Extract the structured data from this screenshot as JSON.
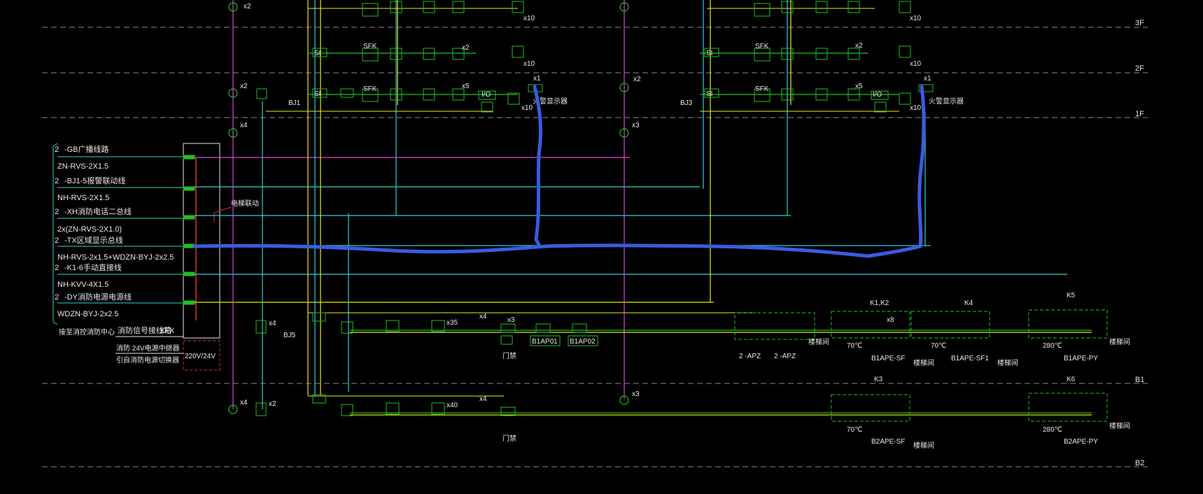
{
  "floors": [
    {
      "key": "3F",
      "label": "3F"
    },
    {
      "key": "2F",
      "label": "2F"
    },
    {
      "key": "1F",
      "label": "1F"
    },
    {
      "key": "B1",
      "label": "B1"
    },
    {
      "key": "B2",
      "label": "B2"
    }
  ],
  "legend": [
    {
      "count": "2",
      "head": "-GB广播线路",
      "spec": "ZN-RVS-2X1.5",
      "line_color": "#e040e0",
      "mark": "BC"
    },
    {
      "count": "2",
      "head": "-BJ1-5报警联动线",
      "spec": "NH-RVS-2X1.5",
      "line_color": "#30d0d0",
      "mark": ""
    },
    {
      "count": "2",
      "head": "-XH消防电话二总线",
      "spec": "2x(ZN-RVS-2X1.0)",
      "line_color": "#30d0d0",
      "mark": "F"
    },
    {
      "count": "2",
      "head": "-TX区域显示总线",
      "spec": "NH-RVS-2x1.5+WDZN-BYJ-2x2.5",
      "line_color": "#30d0d0",
      "mark": "TX"
    },
    {
      "count": "2",
      "head": "-K1-6手动直接线",
      "spec": "NH-KVV-4X1.5",
      "line_color": "#30d0d0",
      "mark": "PC"
    },
    {
      "count": "2",
      "head": "-DY消防电源电源线",
      "spec": "WDZN-BYJ-2x2.5",
      "line_color": "#e8e820",
      "mark": "D"
    }
  ],
  "panel_notes": {
    "left": "接至消控消防中心",
    "signal": "消防信号接线箱",
    "xfx": "XFX",
    "psu": "消防 24V电源中继器",
    "psu2": "引自消防电源切换器",
    "voltage": "220V/24V",
    "elevator": "电梯联动"
  },
  "bj_labels": {
    "bj1": "BJ1",
    "bj3": "BJ3",
    "bj5": "BJ5"
  },
  "risers": {
    "x2_top": "x2",
    "x2_mid": "x2",
    "x4_mid": "x4",
    "x2_bot": "x2",
    "x4_bot": "x4",
    "x4_left": "x4",
    "x3_mid": "x3",
    "x3_bot": "x3"
  },
  "floor_counts": {
    "x1": "x1",
    "x2": "x2",
    "x5": "x5",
    "x10": "x10",
    "x4": "x4",
    "x35": "x35",
    "x40": "x40",
    "x3": "x3",
    "x8": "x8"
  },
  "device_labels": {
    "io": "I/O",
    "sfk": "SFK",
    "si": "SI",
    "fire_hydrant": "火警显示器",
    "door": "门禁",
    "b1ap01": "B1AP01",
    "b1ap02": "B1AP02",
    "apz1": "2 -APZ",
    "apz2": "2 -APZ",
    "b1ape_sf": "B1APE-SF",
    "b1ape_sf1": "B1APE-SF1",
    "b1ape_py": "B1APE-PY",
    "b2ape_sf": "B2APE-SF",
    "b2ape_py": "B2APE-PY",
    "k12": "K1,K2",
    "k3": "K3",
    "k4": "K4",
    "k5": "K5",
    "k6": "K6",
    "temp70": "70℃",
    "temp280": "280℃",
    "stair": "楼梯间"
  },
  "highlight": {
    "color": "#3a5ce0",
    "meaning": "highlighted route"
  }
}
